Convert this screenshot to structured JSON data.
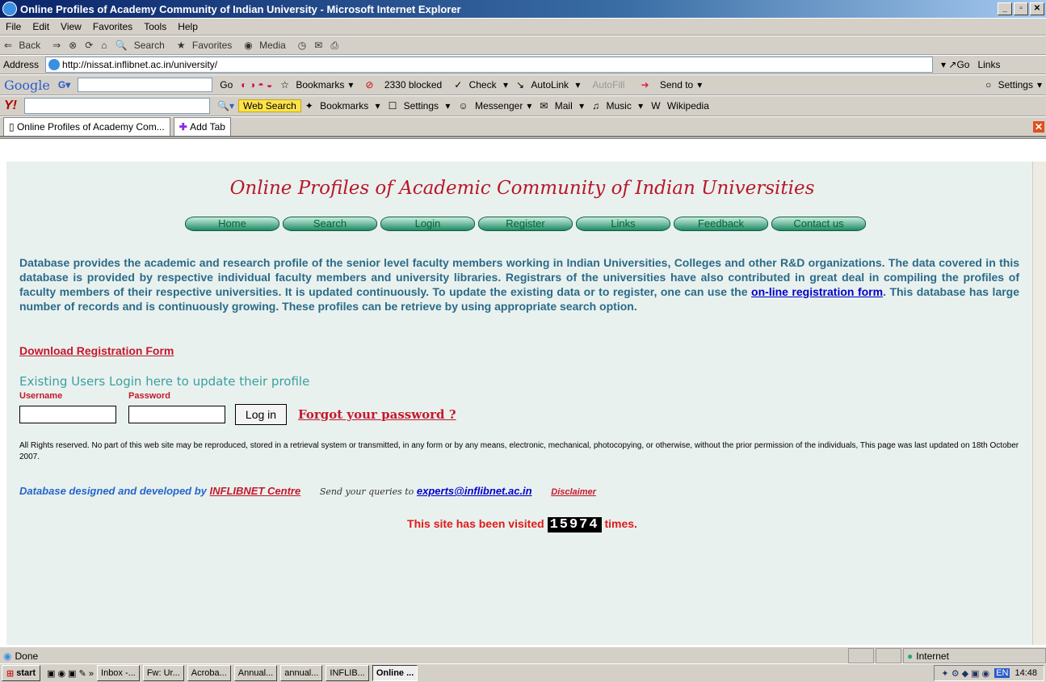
{
  "window": {
    "title": "Online Profiles of Academy Community of Indian University - Microsoft Internet Explorer"
  },
  "menu": [
    "File",
    "Edit",
    "View",
    "Favorites",
    "Tools",
    "Help"
  ],
  "toolbar": {
    "back": "Back",
    "search": "Search",
    "favorites": "Favorites",
    "media": "Media"
  },
  "address": {
    "label": "Address",
    "url": "http://nissat.inflibnet.ac.in/university/",
    "go": "Go",
    "links": "Links"
  },
  "google": {
    "logo": "Google",
    "go": "Go",
    "bookmarks": "Bookmarks",
    "blocked": "2330 blocked",
    "check": "Check",
    "autolink": "AutoLink",
    "autofill": "AutoFill",
    "sendto": "Send to",
    "settings": "Settings"
  },
  "yahoo": {
    "logo": "Y!",
    "websearch": "Web Search",
    "bookmarks": "Bookmarks",
    "settings": "Settings",
    "messenger": "Messenger",
    "mail": "Mail",
    "music": "Music",
    "wikipedia": "Wikipedia"
  },
  "tabs": {
    "current": "Online Profiles of Academy Com...",
    "add": "Add Tab"
  },
  "page": {
    "title": "Online Profiles of Academic Community of Indian Universities",
    "nav": [
      "Home",
      "Search",
      "Login",
      "Register",
      "Links",
      "Feedback",
      "Contact us"
    ],
    "desc_part1": "Database provides the academic and research profile of the senior level faculty members working in Indian Universities, Colleges and other R&D organizations. The data covered in this database is provided by respective individual faculty members and university libraries. Registrars of the universities have also contributed in great deal in compiling the profiles of faculty members of their respective universities. It is updated continuously. To update the existing data or to register, one can use the",
    "desc_link": "on-line registration form",
    "desc_part2": ". This database has large number of records and is continuously growing. These profiles can be retrieve by using appropriate search option.",
    "download": "Download Registration Form",
    "login_heading": "Existing Users Login here to update their profile",
    "username_label": "Username",
    "password_label": "Password",
    "login_button": "Log in",
    "forgot": "Forgot your password ?",
    "rights": "All Rights reserved. No part of this web site may be reproduced, stored in a retrieval system or transmitted, in any form or by any means, electronic, mechanical, photocopying, or otherwise, without the prior permission of the individuals, This page was last updated on 18th October 2007.",
    "credit": "Database designed and developed by",
    "credit_link": "INFLIBNET Centre",
    "queries": "Send your queries to",
    "email": "experts@inflibnet.ac.in",
    "disclaimer": "Disclaimer",
    "visited_pre": "This site has been visited",
    "visited_count": "15974",
    "visited_post": "times."
  },
  "status": {
    "text": "Done",
    "zone": "Internet"
  },
  "taskbar": {
    "start": "start",
    "tasks": [
      "Inbox -...",
      "Fw: Ur...",
      "Acroba...",
      "Annual...",
      "annual...",
      "INFLIB...",
      "Online ..."
    ],
    "clock": "14:48",
    "lang": "EN"
  }
}
